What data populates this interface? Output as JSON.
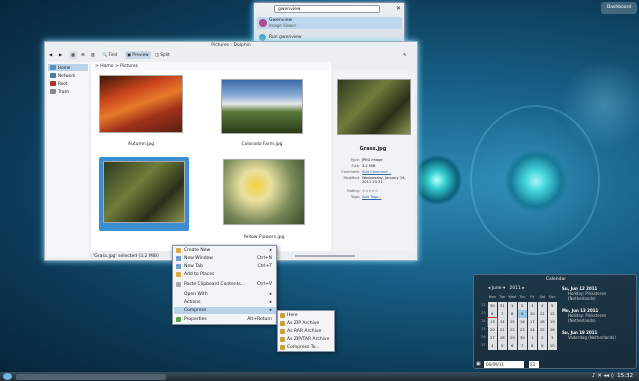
{
  "desktop": {
    "dashboard_label": "Dashboard",
    "clock": "15:32"
  },
  "krunner": {
    "query": "gwenview",
    "results": [
      {
        "title": "Gwenview",
        "subtitle": "Image Viewer"
      },
      {
        "title": "Run gwenview"
      }
    ]
  },
  "dolphin": {
    "title": "Pictures - Dolphin",
    "toolbar": [
      "Find",
      "Preview",
      "Split"
    ],
    "places": [
      "Home",
      "Network",
      "Root",
      "Trash"
    ],
    "breadcrumb": "> Home > Pictures",
    "files": [
      "Autumn.jpg",
      "Colorado Farm.jpg",
      "Grass.jpg",
      "Yellow Flowers.jpg"
    ],
    "status": "'Grass.jpg' selected (3.2 MiB)",
    "info": {
      "name": "Grass.jpg",
      "type_label": "Type:",
      "type": "JPEG image",
      "size_label": "Size:",
      "size": "3.2 MiB",
      "comment_label": "Comment:",
      "comment": "Add Comment...",
      "modified_label": "Modified:",
      "modified": "Wednesday, January 19, 2011 23:21",
      "rating_label": "Rating:",
      "rating": "☆☆☆☆☆",
      "tags_label": "Tags:",
      "tags": "Add Tags..."
    }
  },
  "context_menu": {
    "items": [
      {
        "label": "Create New"
      },
      {
        "label": "New Window",
        "shortcut": "Ctrl+N"
      },
      {
        "label": "New Tab",
        "shortcut": "Ctrl+T"
      },
      {
        "label": "Add to Places"
      },
      {
        "label": "Paste Clipboard Contents...",
        "shortcut": "Ctrl+V"
      },
      {
        "label": "Open With"
      },
      {
        "label": "Actions"
      },
      {
        "label": "Compress"
      },
      {
        "label": "Properties",
        "shortcut": "Alt+Return"
      }
    ]
  },
  "compress_menu": [
    "Here",
    "As ZIP Archive",
    "As RAR Archive",
    "As ZIP/TAR Archive",
    "Compress To..."
  ],
  "calendar": {
    "title": "Calendar",
    "month": "June",
    "year": "2011",
    "weekdays": [
      "Mon",
      "Tue",
      "Wed",
      "Thu",
      "Fri",
      "Sat",
      "Sun"
    ],
    "weeks": [
      {
        "w": "22",
        "d": [
          "30",
          "31",
          "1",
          "2",
          "3",
          "4",
          "5"
        ]
      },
      {
        "w": "23",
        "d": [
          "6",
          "7",
          "8",
          "9",
          "10",
          "11",
          "12"
        ]
      },
      {
        "w": "24",
        "d": [
          "13",
          "14",
          "15",
          "16",
          "17",
          "18",
          "19"
        ]
      },
      {
        "w": "25",
        "d": [
          "20",
          "21",
          "22",
          "23",
          "24",
          "25",
          "26"
        ]
      },
      {
        "w": "26",
        "d": [
          "27",
          "28",
          "29",
          "30",
          "1",
          "2",
          "3"
        ]
      },
      {
        "w": "27",
        "d": [
          "4",
          "5",
          "6",
          "7",
          "8",
          "9",
          "10"
        ]
      }
    ],
    "events": [
      {
        "head": "Su, Jun 12 2011",
        "item": "Holiday: Pinksteren (Netherlands)"
      },
      {
        "head": "Mo, Jun 13 2011",
        "item": "Holiday: Pinksteren (Netherlands)"
      },
      {
        "head": "Su, Jun 19 2011",
        "item": "Vaderdag (Netherlands)"
      }
    ],
    "date_value": "06/09/11",
    "week_value": "23"
  }
}
